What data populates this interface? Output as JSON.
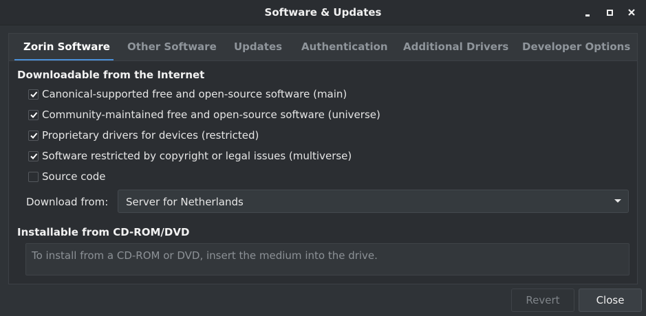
{
  "window": {
    "title": "Software & Updates"
  },
  "tabs": [
    {
      "label": "Zorin Software",
      "active": true
    },
    {
      "label": "Other Software",
      "active": false
    },
    {
      "label": "Updates",
      "active": false
    },
    {
      "label": "Authentication",
      "active": false
    },
    {
      "label": "Additional Drivers",
      "active": false
    },
    {
      "label": "Developer Options",
      "active": false
    }
  ],
  "internet": {
    "title": "Downloadable from the Internet",
    "options": [
      {
        "label": "Canonical-supported free and open-source software (main)",
        "checked": true
      },
      {
        "label": "Community-maintained free and open-source software (universe)",
        "checked": true
      },
      {
        "label": "Proprietary drivers for devices (restricted)",
        "checked": true
      },
      {
        "label": "Software restricted by copyright or legal issues (multiverse)",
        "checked": true
      },
      {
        "label": "Source code",
        "checked": false
      }
    ],
    "download_label": "Download from:",
    "download_value": "Server for Netherlands"
  },
  "cdrom": {
    "title": "Installable from CD-ROM/DVD",
    "placeholder": "To install from a CD-ROM or DVD, insert the medium into the drive."
  },
  "buttons": {
    "revert": "Revert",
    "close": "Close"
  },
  "colors": {
    "accent": "#4a90d9",
    "window_bg": "#2f3337"
  }
}
